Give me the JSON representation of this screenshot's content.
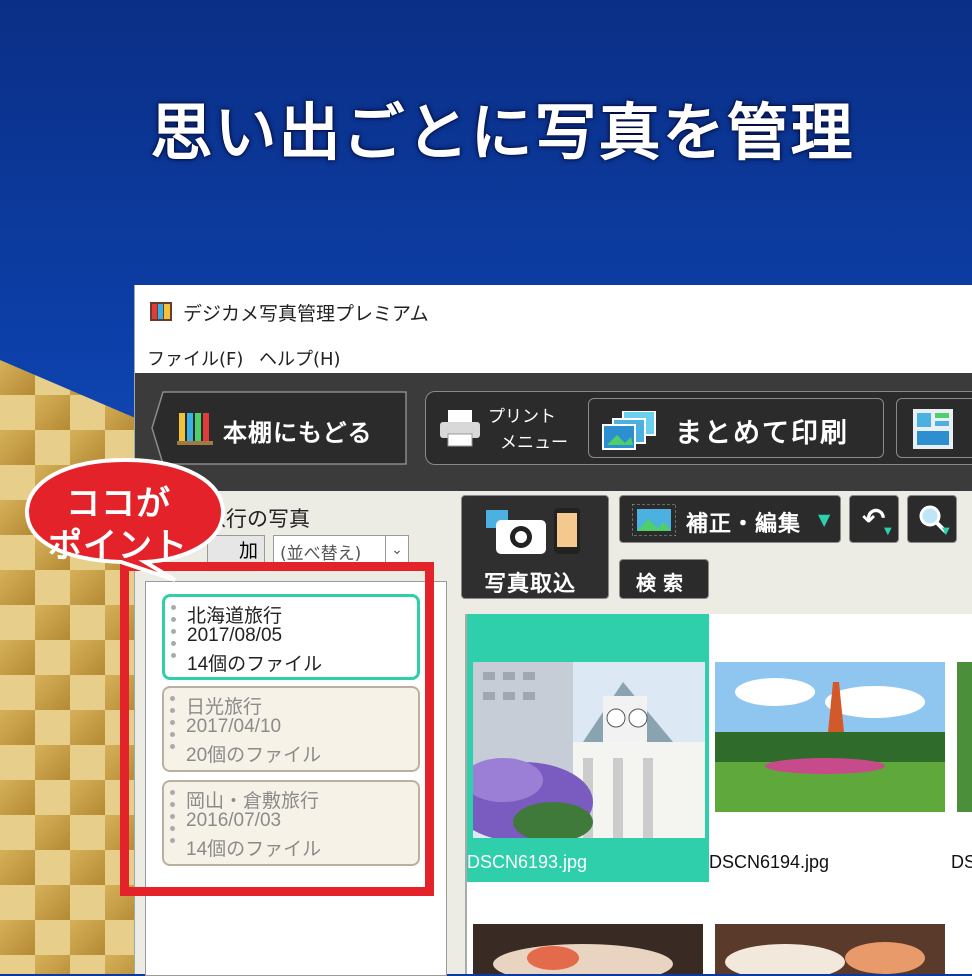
{
  "headline": "思い出ごとに写真を管理",
  "window": {
    "title": "デジカメ写真管理プレミアム",
    "menu": [
      "ファイル(F)",
      "ヘルプ(H)"
    ]
  },
  "toolbar": {
    "back_label": "本棚にもどる",
    "print_menu_line1": "プリント",
    "print_menu_line2": "メニュー",
    "batch_print_label": "まとめて印刷"
  },
  "left_pane": {
    "heading": "旅行の写真",
    "add_label": "加",
    "sort_label": "(並べ替え)",
    "albums": [
      {
        "name": "北海道旅行",
        "date": "2017/08/05",
        "count": "14個のファイル",
        "active": true
      },
      {
        "name": "日光旅行",
        "date": "2017/04/10",
        "count": "20個のファイル",
        "active": false
      },
      {
        "name": "岡山・倉敷旅行",
        "date": "2016/07/03",
        "count": "14個のファイル",
        "active": false
      }
    ]
  },
  "callout": {
    "line1": "ココが",
    "line2": "ポイント"
  },
  "right_pane": {
    "import_label": "写真取込",
    "edit_label": "補正・編集",
    "search_label": "検 索",
    "thumbnails": [
      {
        "filename": "DSCN6193.jpg",
        "selected": true
      },
      {
        "filename": "DSCN6194.jpg",
        "selected": false
      },
      {
        "filename": "DS",
        "selected": false
      }
    ]
  },
  "colors": {
    "accent": "#2ecfaa",
    "highlight": "#e4222a",
    "toolbar": "#3b3b3b",
    "background": "#0c3fa8"
  }
}
